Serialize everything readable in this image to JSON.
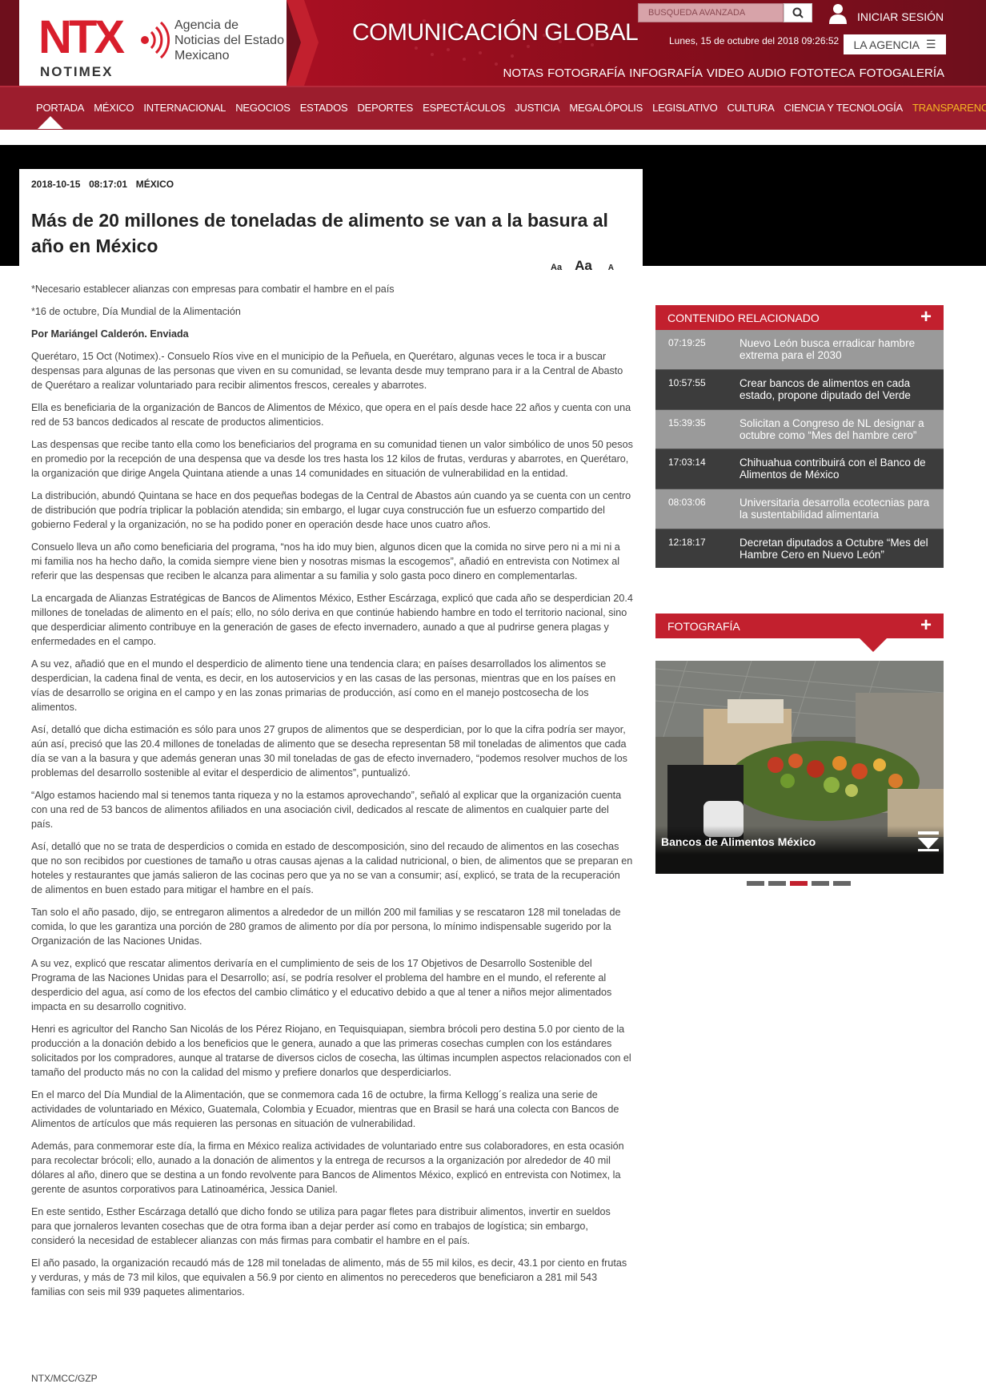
{
  "header": {
    "logo_text": "NTX",
    "logo_sub": "NOTIMEX",
    "agency_name": "Agencia de Noticias del Estado Mexicano",
    "slogan": "COMUNICACIÓN GLOBAL",
    "search_placeholder": "BUSQUEDA AVANZADA",
    "login_label": "INICIAR SESIÓN",
    "date": "Lunes, 15 de octubre del 2018 09:26:52",
    "agency_button": "LA AGENCIA",
    "top_links": [
      "NOTAS",
      "FOTOGRAFÍA",
      "INFOGRAFÍA",
      "VIDEO",
      "AUDIO",
      "FOTOTECA",
      "FOTOGALERÍA"
    ]
  },
  "nav": {
    "items": [
      "PORTADA",
      "MÉXICO",
      "INTERNACIONAL",
      "NEGOCIOS",
      "ESTADOS",
      "DEPORTES",
      "ESPECTÁCULOS",
      "JUSTICIA",
      "MEGALÓPOLIS",
      "LEGISLATIVO",
      "CULTURA",
      "CIENCIA Y TECNOLOGÍA",
      "TRANSPARENCIA"
    ],
    "highlight_color": "#f5b623"
  },
  "article": {
    "date": "2018-10-15",
    "time": "08:17:01",
    "section": "MÉXICO",
    "title": "Más de 20 millones de toneladas de alimento se van a la basura al año en México",
    "font_controls": [
      "Aa",
      "Aa",
      "A"
    ],
    "paragraphs": [
      "*Necesario establecer alianzas con empresas para combatir el hambre en el país",
      "*16 de octubre, Día Mundial de la Alimentación",
      "Por Mariángel Calderón. Enviada",
      "Querétaro, 15 Oct (Notimex).- Consuelo Ríos vive en el municipio de la Peñuela, en Querétaro, algunas veces le toca ir a buscar despensas para algunas de las personas que viven en su comunidad, se levanta desde muy temprano para ir a la Central de Abasto de Querétaro a realizar voluntariado para recibir alimentos frescos, cereales y abarrotes.",
      "Ella es beneficiaria de la organización de Bancos de Alimentos de México, que opera en el país desde hace 22 años y cuenta con una red de 53 bancos dedicados al rescate de productos alimenticios.",
      "Las despensas que recibe tanto ella como los beneficiarios del programa en su comunidad tienen un valor simbólico de unos 50 pesos en promedio por la recepción de una despensa que va desde los tres hasta los 12 kilos de frutas, verduras y abarrotes, en Querétaro, la organización que dirige Angela Quintana atiende a unas 14 comunidades en situación de vulnerabilidad en la entidad.",
      "La distribución, abundó Quintana se hace en dos pequeñas bodegas de la Central de Abastos aún cuando ya se cuenta con un centro de distribución que podría triplicar la población atendida; sin embargo, el lugar cuya construcción fue un esfuerzo compartido del gobierno Federal y la organización, no se ha podido poner en operación desde hace unos cuatro años.",
      "Consuelo lleva un año como beneficiaria del programa, “nos ha ido muy bien, algunos dicen que la comida no sirve pero ni a mi ni a mi familia nos ha hecho daño, la comida siempre viene bien y nosotras mismas la escogemos”, añadió en entrevista con Notimex al referir que las despensas que reciben le alcanza para alimentar a su familia y solo gasta poco dinero en complementarlas.",
      "La encargada de Alianzas Estratégicas de Bancos de Alimentos México, Esther Escárzaga, explicó que cada año se desperdician 20.4 millones de toneladas de alimento en el país; ello, no sólo deriva en que continúe habiendo hambre en todo el territorio nacional, sino que desperdiciar alimento contribuye en la generación de gases de efecto invernadero, aunado a que al pudrirse genera plagas y enfermedades en el campo.",
      "A su vez, añadió que en el mundo el desperdicio de alimento tiene una tendencia clara;  en países desarrollados los alimentos se desperdician, la cadena final de venta, es decir, en los autoservicios y en las casas de las personas, mientras que en los países en vías de desarrollo se origina en el campo y en las zonas primarias de producción, así como en el manejo postcosecha de los alimentos.",
      "Así, detalló que dicha estimación es sólo para unos 27 grupos de alimentos que se desperdician, por lo que la cifra podría ser mayor, aún así, precisó que las 20.4 millones de toneladas de alimento que se desecha representan 58 mil toneladas de alimentos que cada día se van a la basura y que además generan unas 30 mil toneladas de gas de efecto invernadero, “podemos resolver muchos de los problemas del desarrollo sostenible al evitar el desperdicio de alimentos”, puntualizó.",
      "“Algo estamos haciendo mal si tenemos tanta riqueza y no la estamos aprovechando”, señaló al explicar que la organización cuenta con una red de 53 bancos de alimentos afiliados en una asociación civil, dedicados al rescate de alimentos en cualquier parte del país.",
      "Así, detalló que no se trata de desperdicios o comida en estado de descomposición, sino del recaudo de alimentos en las cosechas que no son recibidos por cuestiones de tamaño u otras causas ajenas a la calidad nutricional, o bien, de alimentos que se preparan en hoteles y restaurantes que jamás salieron de las cocinas pero que ya no se van a consumir; así, explicó, se trata de la recuperación de alimentos en buen estado para mitigar el hambre en el país.",
      "Tan solo el año pasado, dijo, se entregaron alimentos a alrededor de un millón 200 mil familias y se rescataron 128 mil toneladas de comida, lo que les garantiza una porción de 280 gramos de alimento por día por persona, lo mínimo indispensable sugerido por la Organización de las Naciones Unidas.",
      "A su vez, explicó que rescatar alimentos derivaría en el cumplimiento de seis de los 17 Objetivos de Desarrollo Sostenible del Programa de las Naciones Unidas para el Desarrollo; así, se podría resolver el problema del hambre en el mundo, el referente al desperdicio del agua, así como de los efectos del cambio climático y el educativo debido a que al tener a niños mejor alimentados impacta en su desarrollo cognitivo.",
      "Henri es agricultor del Rancho San Nicolás de los Pérez Riojano, en Tequisquiapan, siembra brócoli pero destina 5.0 por ciento de la producción a la donación debido a los beneficios que le genera, aunado a que las primeras cosechas cumplen con los estándares solicitados por los compradores, aunque al tratarse de diversos ciclos de cosecha, las últimas incumplen aspectos relacionados con el tamaño del producto más no con la calidad del mismo y prefiere donarlos que desperdiciarlos.",
      "En el marco del Día Mundial de la Alimentación, que se conmemora cada 16 de octubre, la firma Kellogg´s realiza una serie de actividades de voluntariado en México, Guatemala, Colombia y Ecuador, mientras que en Brasil se hará una colecta con Bancos de Alimentos de artículos que más requieren las personas en situación de vulnerabilidad.",
      "Además, para conmemorar este día, la firma en México realiza actividades de voluntariado entre sus colaboradores, en esta ocasión para recolectar brócoli; ello, aunado a la donación de alimentos y la entrega de recursos a la organización por alrededor de 40 mil dólares al año, dinero que se destina a un fondo revolvente para Bancos de Alimentos México, explicó en entrevista con Notimex, la gerente de asuntos corporativos para Latinoamérica, Jessica Daniel.",
      "En este sentido, Esther Escárzaga detalló que dicho fondo se utiliza para pagar fletes para distribuir alimentos, invertir en sueldos para que jornaleros levanten cosechas que de otra forma iban a dejar perder así como en trabajos de logística; sin embargo, consideró la necesidad de establecer alianzas con más firmas para combatir el hambre en el país.",
      "El año pasado, la organización recaudó más de 128 mil toneladas de alimento, más de 55 mil kilos, es decir, 43.1 por ciento en frutas y verduras, y más de 73 mil kilos, que equivalen a 56.9 por ciento en alimentos no perecederos que beneficiaron a 281 mil 543 familias con seis mil 939 paquetes alimentarios."
    ],
    "signature": "NTX/MCC/GZP"
  },
  "sidebar": {
    "related_title": "CONTENIDO RELACIONADO",
    "plus": "+",
    "related": [
      {
        "time": "07:19:25",
        "title": "Nuevo León busca erradicar hambre extrema para el 2030"
      },
      {
        "time": "10:57:55",
        "title": "Crear bancos de alimentos en cada estado, propone diputado del Verde"
      },
      {
        "time": "15:39:35",
        "title": "Solicitan a Congreso de NL designar a octubre como “Mes del hambre cero”"
      },
      {
        "time": "17:03:14",
        "title": "Chihuahua contribuirá con el Banco de Alimentos de México"
      },
      {
        "time": "08:03:06",
        "title": "Universitaria desarrolla ecotecnias para la sustentabilidad alimentaria"
      },
      {
        "time": "12:18:17",
        "title": "Decretan diputados a Octubre “Mes del Hambre Cero en Nuevo León”"
      }
    ],
    "photo_title": "FOTOGRAFÍA",
    "photo_caption": "Bancos de Alimentos México",
    "active_slide": 3,
    "slide_count": 5
  },
  "colors": {
    "brand_red": "#c2202e",
    "nav_red": "#9c1d2d",
    "header_dark": "#6e0f1c"
  }
}
